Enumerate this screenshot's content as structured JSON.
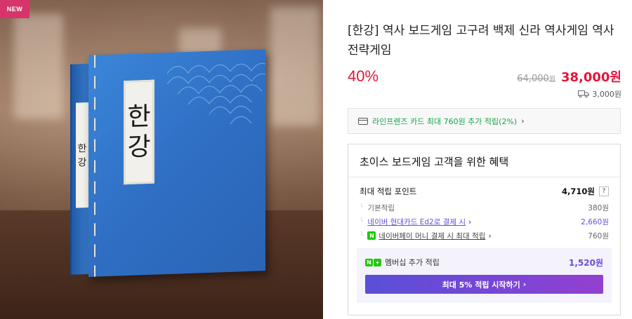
{
  "image": {
    "badge": "NEW",
    "cover_text": [
      "한",
      "강"
    ],
    "spine_text": [
      "한",
      "강"
    ]
  },
  "product": {
    "title": "[한강] 역사 보드게임 고구려 백제 신라 역사게임 역사전략게임",
    "discount": "40%",
    "original_price": "64,000",
    "original_price_unit": "원",
    "sale_price": "38,000원",
    "shipping_fee": "3,000원",
    "icons": {
      "shipping": "truck-icon",
      "card": "card-icon"
    }
  },
  "card_banner": {
    "text": "라인프렌즈 카드 최대 760원 추가 적립(2%)",
    "chevron": "›"
  },
  "benefits": {
    "title": "초이스 보드게임 고객을 위한 혜택",
    "max_points_label": "최대 적립 포인트",
    "max_points_value": "4,710원",
    "help": "?",
    "rows": [
      {
        "label": "기본적립",
        "value": "380원"
      },
      {
        "label": "네이버 현대카드 Ed2로 결제 시",
        "value": "2,660원"
      },
      {
        "label": "네이버페이 머니 결제 시 최대 적립",
        "value": "760원"
      }
    ],
    "npay_badge": "N",
    "membership": {
      "badge": [
        "N",
        "+"
      ],
      "label": "멤버십 추가 적립",
      "value": "1,520원",
      "button_label": "최대 5% 적립 시작하기",
      "button_chevron": "›"
    }
  },
  "colors": {
    "discount_red": "#e5153b",
    "naver_green": "#1ec800",
    "membership_purple": "#6b4dd6",
    "badge_pink": "#d6346b"
  }
}
